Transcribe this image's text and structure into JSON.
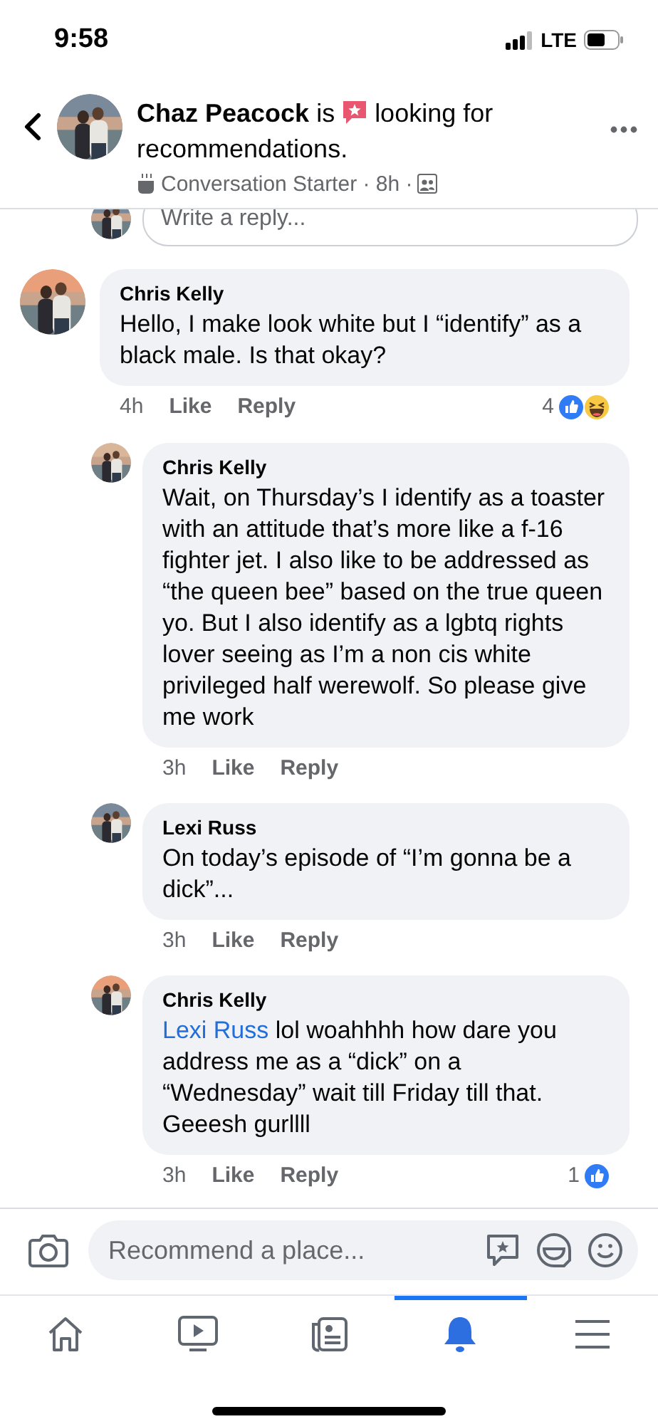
{
  "status_bar": {
    "time": "9:58",
    "network": "LTE"
  },
  "header": {
    "title_before": "**Chaz Peacock** is",
    "title_after": "looking for",
    "title_line2": "recommendations.",
    "meta": "Conversation Starter · 8h ·"
  },
  "reply_field": {
    "placeholder": "Write a reply..."
  },
  "comments": [
    {
      "kind": "top",
      "author": "Chris Kelly",
      "text": "Hello, I make look white but I “identify” as a black male. Is that okay?",
      "time": "4h",
      "like": "Like",
      "reply": "Reply",
      "reaction_count": "4",
      "laughing_reaction": true
    },
    {
      "kind": "reply",
      "author": "Chris Kelly",
      "text": "Wait, on Thursday’s I identify as a toaster with an attitude that’s more like a f-16 fighter jet. I also like to be addressed as “the queen bee” based on the true queen yo. But I also identify as a lgbtq rights lover seeing as I’m a non cis white privileged half werewolf. So please give me work",
      "time": "3h",
      "like": "Like",
      "reply": "Reply"
    },
    {
      "kind": "reply",
      "author": "Lexi Russ",
      "text": "On today’s episode of “I’m gonna be a dick”...",
      "time": "3h",
      "like": "Like",
      "reply": "Reply"
    },
    {
      "kind": "reply",
      "author": "Chris Kelly",
      "mention": "Lexi Russ",
      "text": "lol woahhhh how dare you address me as a “dick” on a “Wednesday” wait till Friday till that. Geeesh gurllll",
      "time": "3h",
      "like": "Like",
      "reply": "Reply",
      "reaction_count": "1",
      "laughing_reaction": false
    }
  ],
  "composer": {
    "placeholder": "Recommend a place..."
  },
  "tabs": [
    {
      "kind": "home",
      "selected": false
    },
    {
      "kind": "watch",
      "selected": false
    },
    {
      "kind": "news",
      "selected": false
    },
    {
      "kind": "notifications",
      "selected": true
    },
    {
      "kind": "menu",
      "selected": false
    }
  ]
}
